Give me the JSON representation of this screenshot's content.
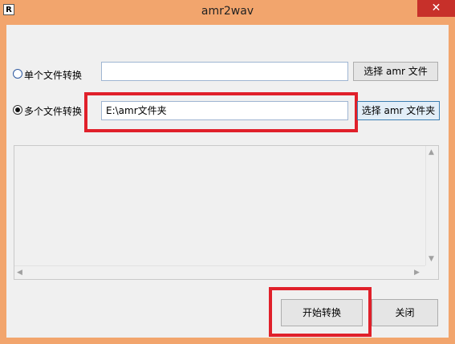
{
  "window": {
    "title": "amr2wav",
    "app_icon_letter": "R",
    "close_symbol": "✕"
  },
  "single": {
    "label": "单个文件转换",
    "checked": false,
    "input_value": "",
    "button_label": "选择 amr 文件"
  },
  "multi": {
    "label": "多个文件转换",
    "checked": true,
    "input_value": "E:\\amr文件夹",
    "button_label": "选择 amr 文件夹"
  },
  "actions": {
    "start_label": "开始转换",
    "close_label": "关闭"
  },
  "colors": {
    "highlight": "#e0202a",
    "frame": "#f2a56d"
  },
  "scroll_arrows": {
    "up": "▲",
    "down": "▼",
    "left": "◀",
    "right": "▶"
  }
}
